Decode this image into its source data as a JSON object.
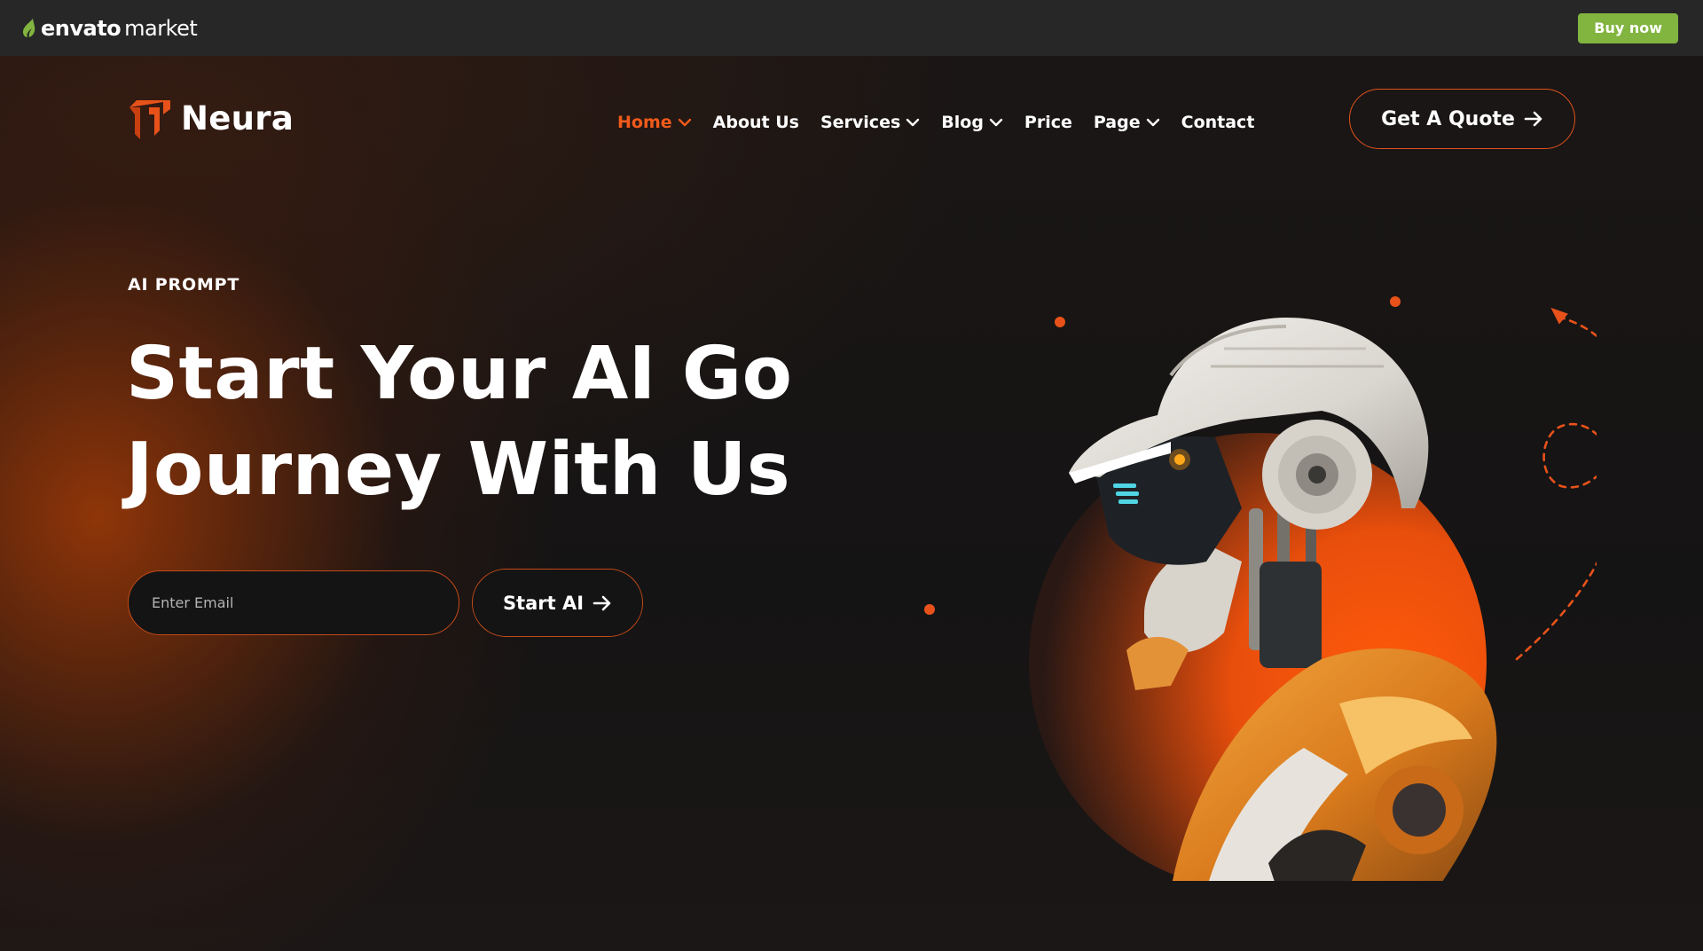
{
  "envato_bar": {
    "logo_word": "envato",
    "logo_suffix": "market",
    "buy_now_label": "Buy now"
  },
  "site": {
    "logo_text": "Neura",
    "nav": [
      {
        "label": "Home",
        "has_dropdown": true,
        "active": true
      },
      {
        "label": "About Us",
        "has_dropdown": false,
        "active": false
      },
      {
        "label": "Services",
        "has_dropdown": true,
        "active": false
      },
      {
        "label": "Blog",
        "has_dropdown": true,
        "active": false
      },
      {
        "label": "Price",
        "has_dropdown": false,
        "active": false
      },
      {
        "label": "Page",
        "has_dropdown": true,
        "active": false
      },
      {
        "label": "Contact",
        "has_dropdown": false,
        "active": false
      }
    ],
    "quote_button_label": "Get A Quote"
  },
  "hero": {
    "eyebrow": "AI PROMPT",
    "headline_line1": "Start Your AI Go",
    "headline_line2": "Journey With Us",
    "email_placeholder": "Enter Email",
    "email_value": "",
    "cta_label": "Start AI",
    "image": "robot-with-hard-hat-illustration"
  },
  "icons": {
    "envato_logo": "envato-leaf-icon",
    "site_logo": "neura-logo-icon",
    "dropdown": "chevron-down-icon",
    "arrow": "arrow-right-icon"
  },
  "colors": {
    "accent": "#e8521a",
    "envato_green": "#82b440",
    "envato_bar_bg": "#272727",
    "page_bg": "#141414"
  }
}
